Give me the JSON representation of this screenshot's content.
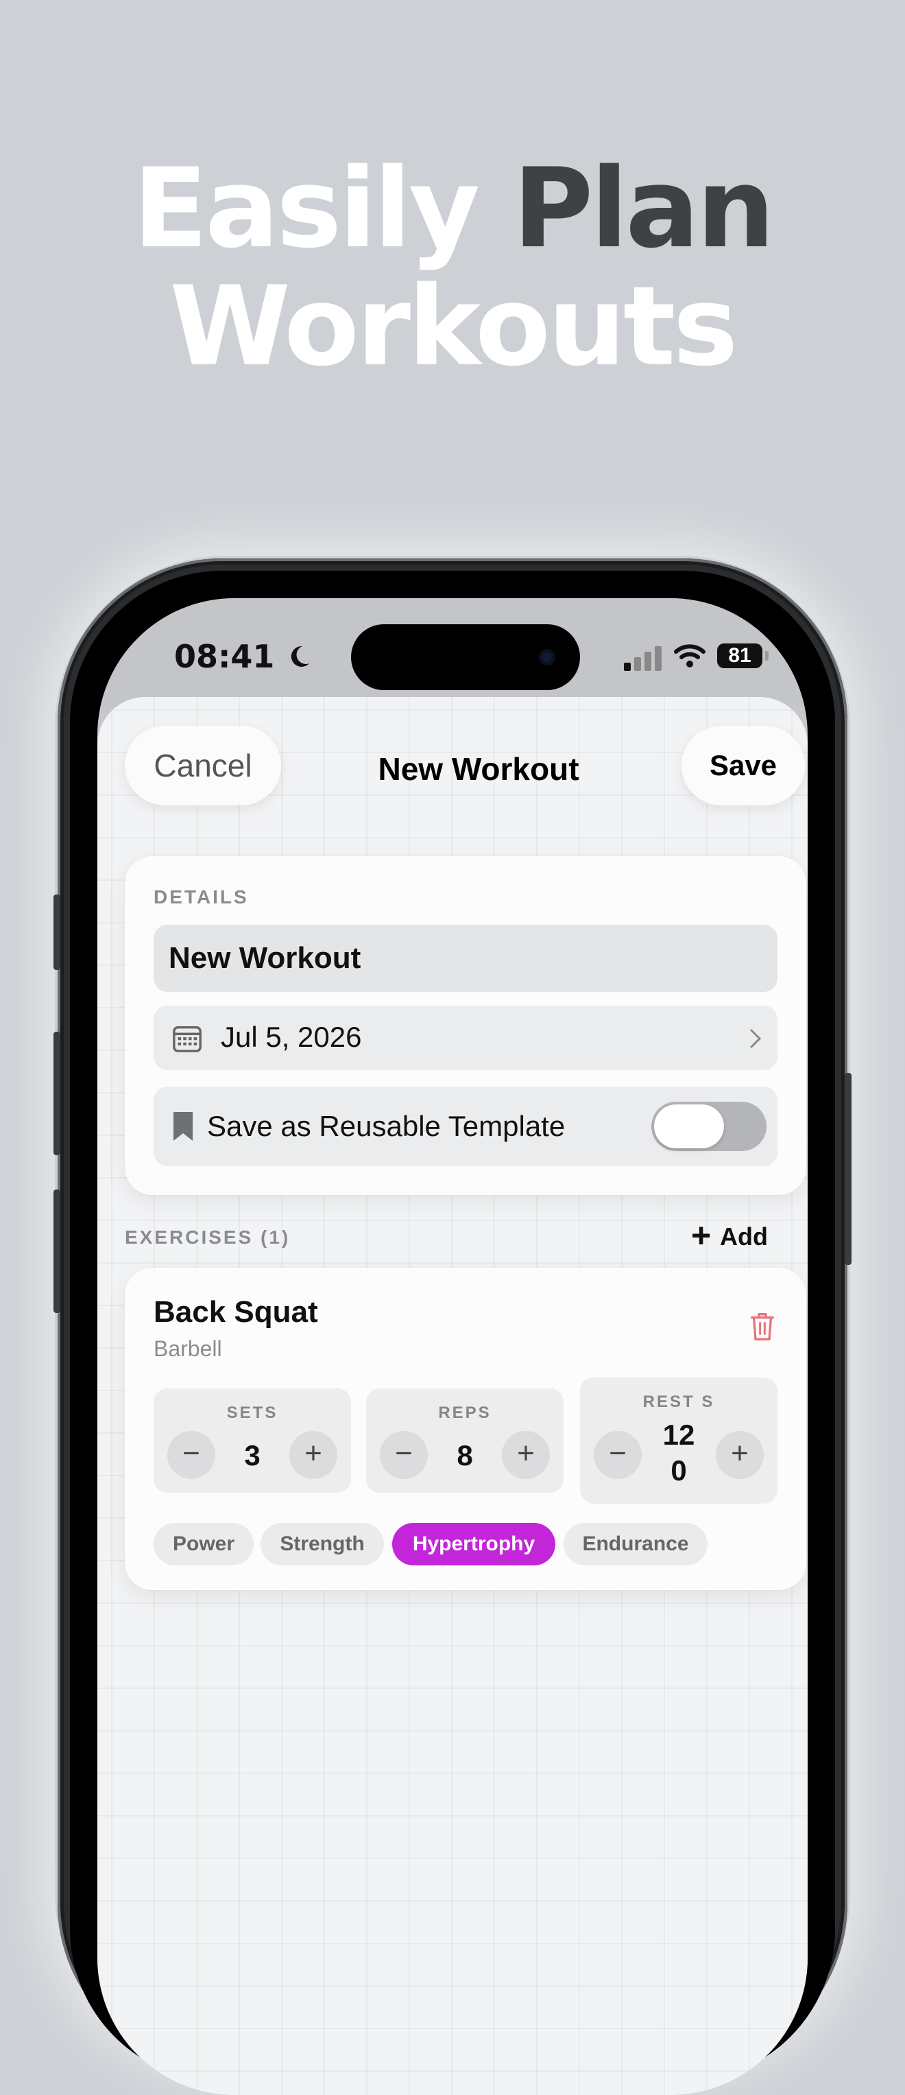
{
  "headline": {
    "line1_light": "Easily",
    "line1_dark": "Plan",
    "line2": "Workouts"
  },
  "status_bar": {
    "time": "08:41",
    "battery": "81"
  },
  "nav": {
    "cancel_label": "Cancel",
    "title": "New Workout",
    "save_label": "Save"
  },
  "details": {
    "section_label": "DETAILS",
    "name_value": "New Workout",
    "date_value": "Jul 5, 2026",
    "template_label": "Save as Reusable Template",
    "template_enabled": false
  },
  "exercises": {
    "section_label": "EXERCISES (1)",
    "add_label": "Add",
    "items": [
      {
        "name": "Back Squat",
        "equipment": "Barbell",
        "sets_label": "SETS",
        "sets": "3",
        "reps_label": "REPS",
        "reps": "8",
        "rest_label": "REST S",
        "rest_line1": "12",
        "rest_line2": "0",
        "goals": [
          "Power",
          "Strength",
          "Hypertrophy",
          "Endurance"
        ],
        "selected_goal": "Hypertrophy"
      }
    ]
  },
  "colors": {
    "accent": "#c325d8",
    "background": "#cdd0d5",
    "danger": "#e8737a"
  }
}
